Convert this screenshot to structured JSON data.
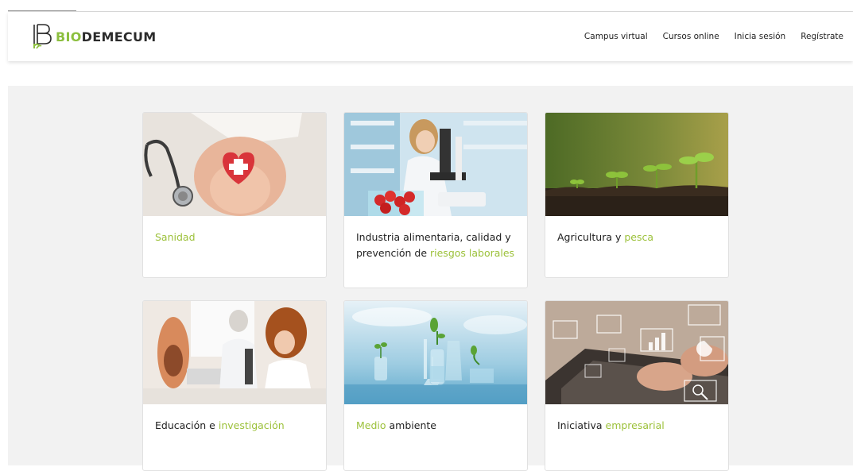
{
  "brand": {
    "prefix": "BIO",
    "suffix": "DEMECUM",
    "accent": "#9cc13a"
  },
  "nav": [
    {
      "label": "Campus virtual"
    },
    {
      "label": "Cursos online"
    },
    {
      "label": "Inicia sesión"
    },
    {
      "label": "Regístrate"
    }
  ],
  "cards": [
    {
      "parts": [
        {
          "text": "Sanidad",
          "accent": true
        }
      ],
      "image": "health-hands-heart-stethoscope"
    },
    {
      "parts": [
        {
          "text": "Industria alimentaria, calidad y prevención de ",
          "accent": false
        },
        {
          "text": "riesgos laborales",
          "accent": true
        }
      ],
      "image": "lab-microscope-strawberries"
    },
    {
      "parts": [
        {
          "text": "Agricultura y ",
          "accent": false
        },
        {
          "text": "pesca",
          "accent": true
        }
      ],
      "image": "seedlings-soil"
    },
    {
      "parts": [
        {
          "text": "Educación e ",
          "accent": false
        },
        {
          "text": "investigación",
          "accent": true
        }
      ],
      "image": "teacher-student-microscope"
    },
    {
      "parts": [
        {
          "text": "Medio",
          "accent": true
        },
        {
          "text": " ambiente",
          "accent": false
        }
      ],
      "image": "plants-in-flasks"
    },
    {
      "parts": [
        {
          "text": "Iniciativa ",
          "accent": false
        },
        {
          "text": "empresarial",
          "accent": true
        }
      ],
      "image": "laptop-business-charts"
    }
  ]
}
